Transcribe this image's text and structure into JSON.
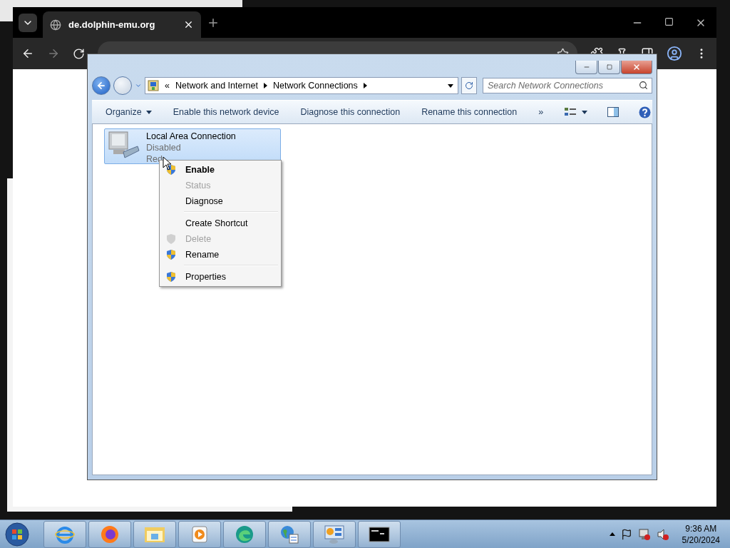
{
  "browser": {
    "tab": {
      "title": "de.dolphin-emu.org"
    }
  },
  "explorer": {
    "breadcrumb_prefix": "«",
    "breadcrumb": [
      "Network and Internet",
      "Network Connections"
    ],
    "search": {
      "placeholder": "Search Network Connections"
    },
    "toolbar": [
      {
        "label": "Organize",
        "kind": "dropdown"
      },
      {
        "label": "Enable this network device",
        "kind": "command"
      },
      {
        "label": "Diagnose this connection",
        "kind": "command"
      },
      {
        "label": "Rename this connection",
        "kind": "command"
      },
      {
        "label": "»",
        "kind": "overflow"
      }
    ],
    "items": [
      {
        "name": "Local Area Connection",
        "status": "Disabled",
        "device": "Red",
        "selected": true
      }
    ]
  },
  "context_menu": [
    {
      "kind": "item",
      "label": "Enable",
      "default": true,
      "disabled": false,
      "shield": true
    },
    {
      "kind": "item",
      "label": "Status",
      "default": false,
      "disabled": true,
      "shield": false
    },
    {
      "kind": "item",
      "label": "Diagnose",
      "default": false,
      "disabled": false,
      "shield": false
    },
    {
      "kind": "separator"
    },
    {
      "kind": "item",
      "label": "Create Shortcut",
      "default": false,
      "disabled": false,
      "shield": false
    },
    {
      "kind": "item",
      "label": "Delete",
      "default": false,
      "disabled": true,
      "shield": true
    },
    {
      "kind": "item",
      "label": "Rename",
      "default": false,
      "disabled": false,
      "shield": true
    },
    {
      "kind": "separator"
    },
    {
      "kind": "item",
      "label": "Properties",
      "default": false,
      "disabled": false,
      "shield": true
    }
  ],
  "taskbar": {
    "clock": {
      "time": "9:36 AM",
      "date": "5/20/2024"
    }
  }
}
